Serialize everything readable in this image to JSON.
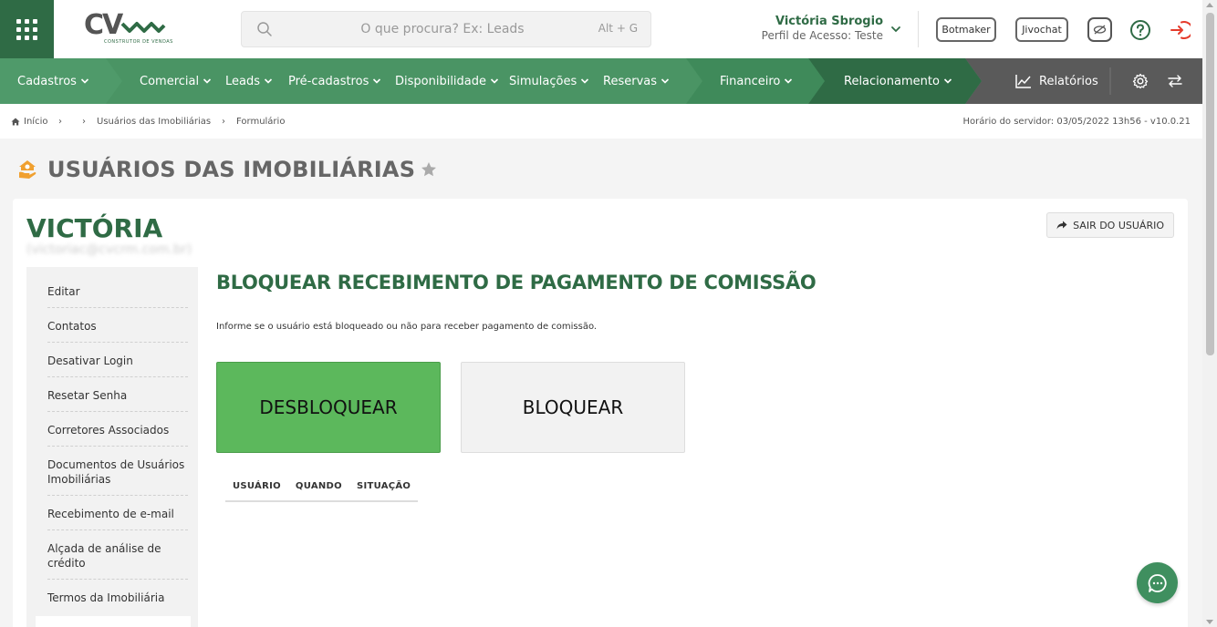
{
  "header": {
    "logo_text": "CV",
    "logo_subtitle": "CONSTRUTOR DE VENDAS",
    "search": {
      "placeholder": "O que procura? Ex: Leads",
      "shortcut": "Alt + G"
    },
    "user": {
      "name": "Victória Sbrogio",
      "profile": "Perfil de Acesso: Teste"
    },
    "buttons": {
      "botmaker": "Botmaker",
      "jivochat": "Jivochat"
    },
    "icons": [
      "apps-grid-icon",
      "search-icon",
      "chevron-down-icon",
      "eye-slash-icon",
      "help-icon",
      "logout-icon"
    ]
  },
  "nav": {
    "items": [
      {
        "label": "Cadastros"
      },
      {
        "label": "Comercial"
      },
      {
        "label": "Leads"
      },
      {
        "label": "Pré-cadastros"
      },
      {
        "label": "Disponibilidade"
      },
      {
        "label": "Simulações"
      },
      {
        "label": "Reservas"
      },
      {
        "label": "Financeiro"
      },
      {
        "label": "Relacionamento"
      },
      {
        "label": "Relatórios"
      }
    ],
    "colors": {
      "light": "#4f9a6a",
      "mid": "#3f8a5a",
      "dark": "#2f6b45",
      "gray": "#5a5a5a"
    }
  },
  "breadcrumb": {
    "home": "Início",
    "items": [
      "Usuários das Imobiliárias",
      "Formulário"
    ],
    "server_time": "Horário do servidor: 03/05/2022 13h56 - v10.0.21"
  },
  "page": {
    "title": "USUÁRIOS DAS IMOBILIÁRIAS"
  },
  "user_card": {
    "name": "VICTÓRIA",
    "email": "(victoriac@cvcrm.com.br)",
    "exit_label": "SAIR DO USUÁRIO"
  },
  "side_menu": {
    "items": [
      {
        "label": "Editar"
      },
      {
        "label": "Contatos"
      },
      {
        "label": "Desativar Login"
      },
      {
        "label": "Resetar Senha"
      },
      {
        "label": "Corretores Associados"
      },
      {
        "label": "Documentos de Usuários Imobiliárias"
      },
      {
        "label": "Recebimento de e-mail"
      },
      {
        "label": "Alçada de análise de crédito"
      },
      {
        "label": "Termos da Imobiliária"
      }
    ]
  },
  "section": {
    "title": "BLOQUEAR RECEBIMENTO DE PAGAMENTO DE COMISSÃO",
    "description": "Informe se o usuário está bloqueado ou não para receber pagamento de comissão.",
    "unblock_label": "DESBLOQUEAR",
    "block_label": "BLOQUEAR",
    "table_headers": [
      "USUÁRIO",
      "QUANDO",
      "SITUAÇÃO"
    ]
  },
  "colors": {
    "brand_green": "#2f6b45",
    "unblock_green": "#5cb85c"
  }
}
